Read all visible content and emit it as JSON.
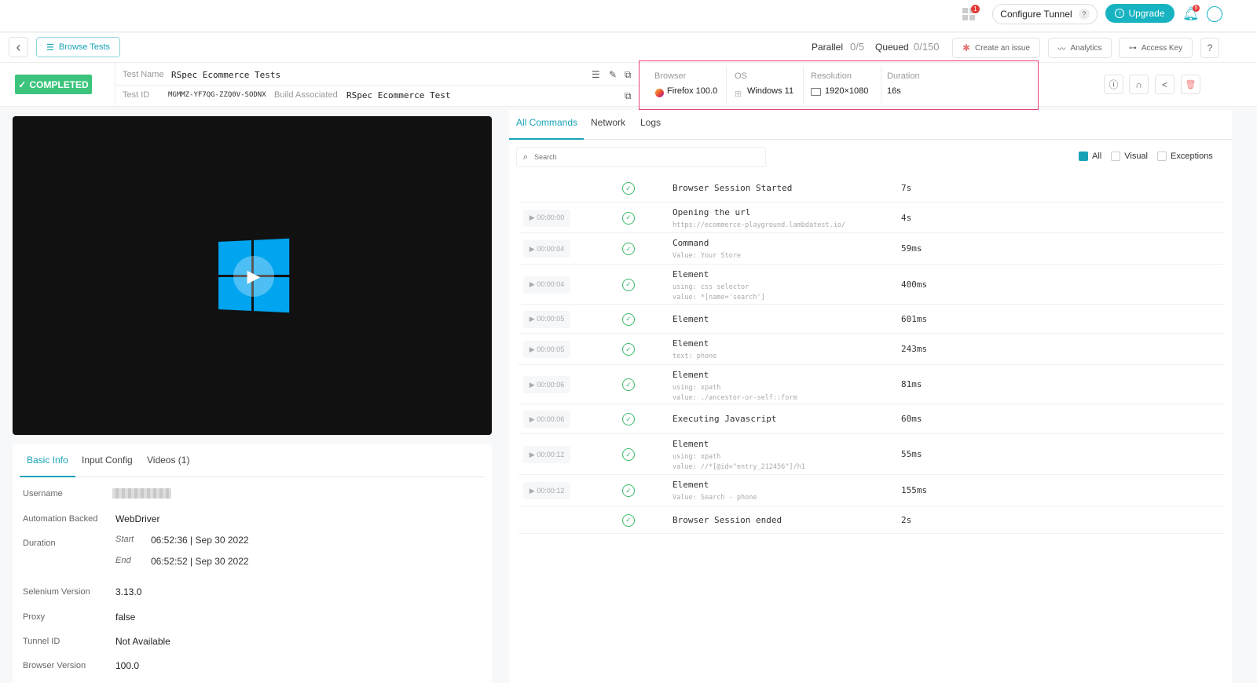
{
  "topbar": {
    "apps_badge": "1",
    "configure_tunnel": "Configure Tunnel",
    "help": "?",
    "upgrade": "Upgrade",
    "notif_badge": "5"
  },
  "toolbar": {
    "back": "‹",
    "browse_tests": "Browse Tests",
    "parallel_label": "Parallel",
    "parallel_value": "0/5",
    "queued_label": "Queued",
    "queued_value": "0/150",
    "create_issue": "Create an issue",
    "analytics": "Analytics",
    "access_key": "Access Key",
    "help": "?"
  },
  "test": {
    "status": "COMPLETED",
    "name_label": "Test Name",
    "name": "RSpec Ecommerce Tests",
    "id_label": "Test ID",
    "id": "MGMMZ-YF7QG-ZZQ0V-SODNX",
    "build_label": "Build Associated",
    "build": "RSpec Ecommerce Test"
  },
  "env": {
    "browser_label": "Browser",
    "browser": "Firefox 100.0",
    "os_label": "OS",
    "os": "Windows 11",
    "resolution_label": "Resolution",
    "resolution": "1920×1080",
    "duration_label": "Duration",
    "duration": "16s"
  },
  "info_tabs": [
    "Basic Info",
    "Input Config",
    "Videos (1)"
  ],
  "basic_info": {
    "username_label": "Username",
    "automation_label": "Automation Backed",
    "automation": "WebDriver",
    "duration_label": "Duration",
    "start_label": "Start",
    "start_time": "06:52:36",
    "start_date": "Sep 30 2022",
    "end_label": "End",
    "end_time": "06:52:52",
    "end_date": "Sep 30 2022",
    "selenium_label": "Selenium Version",
    "selenium": "3.13.0",
    "proxy_label": "Proxy",
    "proxy": "false",
    "tunnel_label": "Tunnel ID",
    "tunnel": "Not Available",
    "browser_version_label": "Browser Version",
    "browser_version": "100.0"
  },
  "cmd_tabs": [
    "All Commands",
    "Network",
    "Logs"
  ],
  "search": {
    "placeholder": "Search"
  },
  "filters": [
    "All",
    "Visual",
    "Exceptions"
  ],
  "commands": [
    {
      "ts": "",
      "name": "Browser Session Started",
      "subs": [],
      "dur": "7s"
    },
    {
      "ts": "▶ 00:00:00",
      "name": "Opening the url",
      "subs": [
        "https://ecommerce-playground.lambdatest.io/"
      ],
      "dur": "4s"
    },
    {
      "ts": "▶ 00:00:04",
      "name": "Command",
      "subs": [
        "Value: Your Store"
      ],
      "dur": "59ms"
    },
    {
      "ts": "▶ 00:00:04",
      "name": "Element",
      "subs": [
        "using: css selector",
        "value: *[name='search']"
      ],
      "dur": "400ms"
    },
    {
      "ts": "▶ 00:00:05",
      "name": "Element",
      "subs": [],
      "dur": "601ms"
    },
    {
      "ts": "▶ 00:00:05",
      "name": "Element",
      "subs": [
        "text: phone"
      ],
      "dur": "243ms"
    },
    {
      "ts": "▶ 00:00:06",
      "name": "Element",
      "subs": [
        "using: xpath",
        "value: ./ancestor-or-self::form"
      ],
      "dur": "81ms"
    },
    {
      "ts": "▶ 00:00:06",
      "name": "Executing Javascript",
      "subs": [],
      "dur": "60ms"
    },
    {
      "ts": "▶ 00:00:12",
      "name": "Element",
      "subs": [
        "using: xpath",
        "value: //*[@id=\"entry_212456\"]/h1"
      ],
      "dur": "55ms"
    },
    {
      "ts": "▶ 00:00:12",
      "name": "Element",
      "subs": [
        "Value: Search - phone"
      ],
      "dur": "155ms"
    },
    {
      "ts": "",
      "name": "Browser Session ended",
      "subs": [],
      "dur": "2s"
    }
  ]
}
